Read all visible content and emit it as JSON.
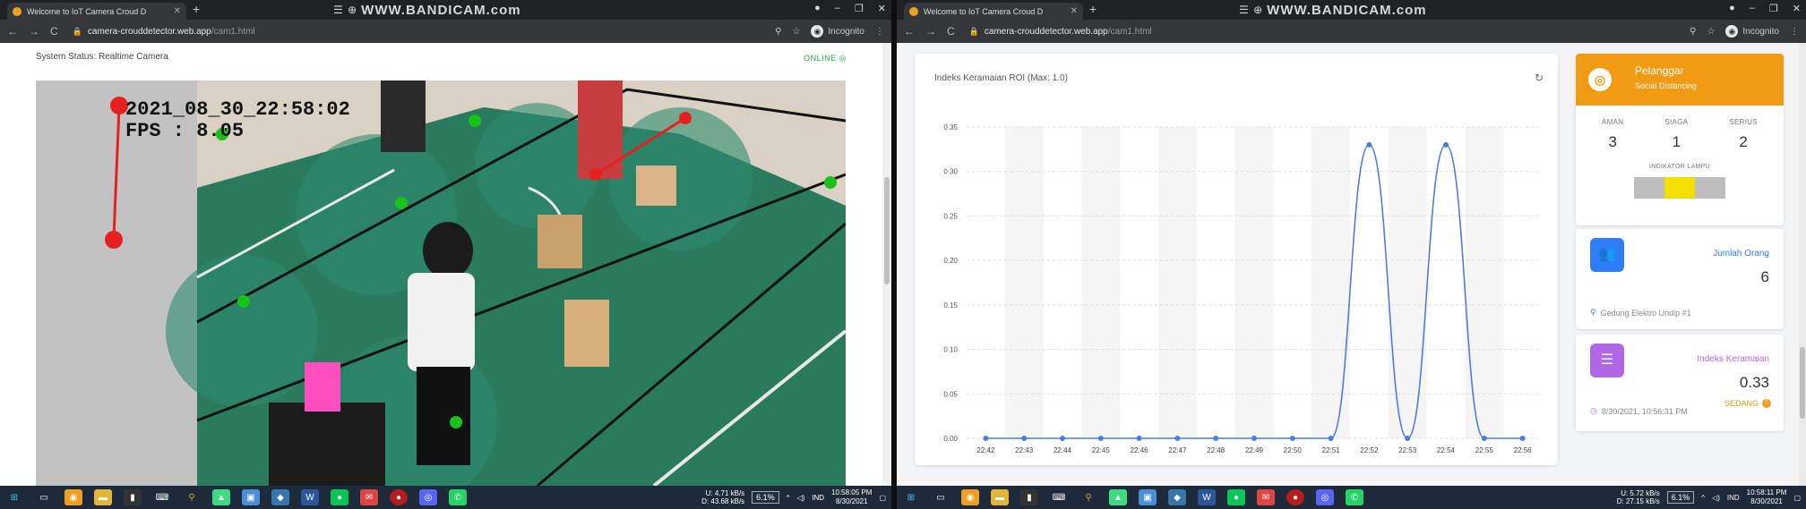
{
  "left": {
    "tab_title": "Welcome to IoT Camera Croud D",
    "recorder_prefix": "☰ ⊕",
    "recorder": "WWW.BANDICAM.com",
    "url_host": "camera-crouddetector.web.app",
    "url_path": "/cam1.html",
    "incognito": "Incognito",
    "system_status": "System Status: Realtime Camera",
    "online": "ONLINE",
    "overlay_timestamp": "2021_08_30_22:58:02",
    "overlay_fps": "FPS : 8.05",
    "net_up": "U:     4.71 kB/s",
    "net_down": "D:   43.68 kB/s",
    "cpu": "6.1%",
    "lang": "IND",
    "clock_time": "10:58:05 PM",
    "clock_date": "8/30/2021"
  },
  "right": {
    "tab_title": "Welcome to IoT Camera Croud D",
    "recorder_prefix": "☰ ⊕",
    "recorder": "WWW.BANDICAM.com",
    "url_host": "camera-crouddetector.web.app",
    "url_path": "/cam1.html",
    "incognito": "Incognito",
    "net_up": "U:     5.72 kB/s",
    "net_down": "D:   27.15 kB/s",
    "cpu": "6.1%",
    "lang": "IND",
    "clock_time": "10:58:11 PM",
    "clock_date": "8/30/2021",
    "pelanggar": {
      "title": "Pelanggar",
      "subtitle": "Social Distancing",
      "aman_label": "AMAN",
      "aman_value": "3",
      "siaga_label": "SIAGA",
      "siaga_value": "1",
      "serius_label": "SERIUS",
      "serius_value": "2",
      "indikator_label": "INDIKATOR LAMPU",
      "active_lamp": "yellow",
      "lamp_color_active": "#f4e000"
    },
    "jumlah": {
      "label": "Jumlah Orang",
      "value": "6",
      "location": "Gedung Elektro Undip #1",
      "icon_color": "#2f7ef7"
    },
    "indeks": {
      "label": "Indeks Keramaian",
      "value": "0.33",
      "timestamp": "8/30/2021, 10:56:31 PM",
      "status": "SEDANG",
      "icon_color": "#b067e6"
    }
  },
  "chart_data": {
    "type": "line",
    "title": "Indeks Keramaian ROI (Max: 1.0)",
    "categories": [
      "22:42",
      "22:43",
      "22:44",
      "22:45",
      "22:46",
      "22:47",
      "22:48",
      "22:49",
      "22:50",
      "22:51",
      "22:52",
      "22:53",
      "22:54",
      "22:55",
      "22:56"
    ],
    "series": [
      {
        "values": [
          0,
          0,
          0,
          0,
          0,
          0,
          0,
          0,
          0,
          0,
          0.33,
          0,
          0.33,
          0,
          0
        ]
      }
    ],
    "yticks": [
      "0.00",
      "0.05",
      "0.10",
      "0.15",
      "0.20",
      "0.25",
      "0.30",
      "0.35"
    ],
    "ylim": [
      0,
      0.35
    ],
    "grid": true,
    "line_color": "#4a7fe0"
  },
  "icons": {
    "taskbar": [
      "windows-icon",
      "task-view-icon",
      "chrome-icon",
      "file-explorer-icon",
      "terminal-icon",
      "keyboard-icon",
      "search-icon",
      "android-studio-icon",
      "cad-icon",
      "python-icon",
      "word-icon",
      "line-icon",
      "mail-icon",
      "record-icon",
      "discord-icon",
      "whatsapp-icon"
    ]
  }
}
